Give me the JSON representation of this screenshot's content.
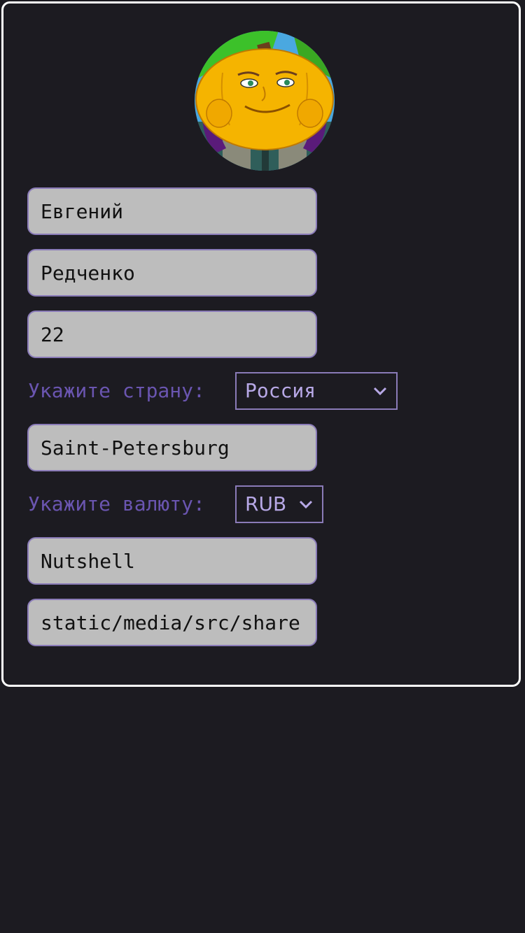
{
  "profile": {
    "avatar_icon": "pumpkin-avatar-icon",
    "first_name": "Евгений",
    "last_name": "Редченко",
    "age": "22",
    "country_label": "Укажите страну:",
    "country_value": "Россия",
    "city": "Saint-Petersburg",
    "currency_label": "Укажите валюту:",
    "currency_value": "RUB",
    "company": "Nutshell",
    "avatar_path": "static/media/src/share"
  },
  "colors": {
    "background": "#1c1b21",
    "card_border": "#ffffff",
    "field_bg": "#bdbdbd",
    "field_border": "#8a7bb8",
    "label": "#6a55b0",
    "select_text": "#b7a8e6"
  }
}
